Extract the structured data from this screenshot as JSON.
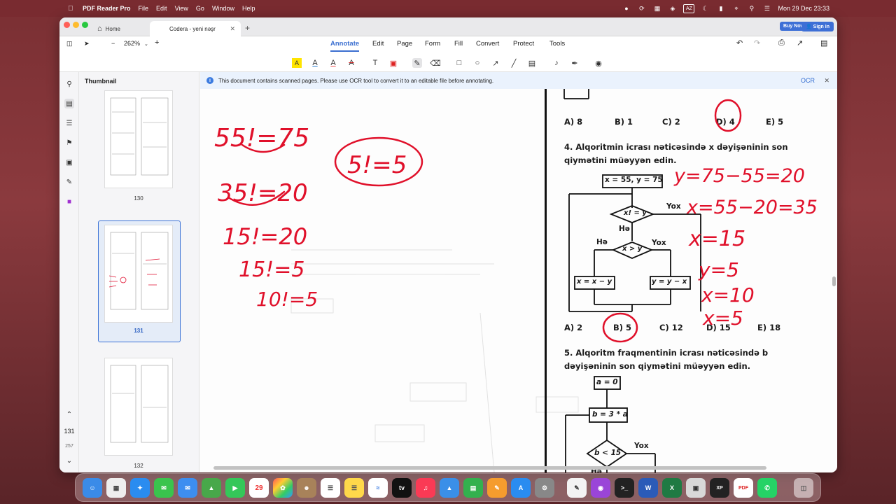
{
  "menubar": {
    "app": "PDF Reader Pro",
    "items": [
      "File",
      "Edit",
      "View",
      "Go",
      "Window",
      "Help"
    ],
    "clock": "Mon 29 Dec  23:33",
    "input_source": "AZ"
  },
  "tabs": {
    "home": "Home",
    "doc": "Codera - yeni nəşr"
  },
  "account": {
    "buy": "Buy Now",
    "signin": "Sign in"
  },
  "toolbar": {
    "zoom": "262%",
    "menu": [
      "Annotate",
      "Edit",
      "Page",
      "Form",
      "Fill",
      "Convert",
      "Protect",
      "Tools"
    ],
    "active": "Annotate"
  },
  "sidebar": {
    "title": "Thumbnail",
    "pages": [
      "130",
      "131",
      "132"
    ],
    "current_page": "131",
    "total_pages": "257"
  },
  "banner": {
    "message": "This document contains scanned pages. Please use OCR tool to convert it to an editable file before annotating.",
    "ocr": "OCR"
  },
  "doc": {
    "answers_q3": [
      "A) 8",
      "B) 1",
      "C) 2",
      "D) 4",
      "E) 5"
    ],
    "q4_line1": "4. Alqoritmin icrası nəticəsində x dəyişəninin son",
    "q4_line2": "qiymətini müəyyən edin.",
    "q4_start": "x = 55, y = 75",
    "q4_cond1": "x! = y",
    "q4_cond2": "x > y",
    "q4_act_left": "x = x − y",
    "q4_act_right": "y = y − x",
    "yes": "Hə",
    "no": "Yox",
    "answers_q4": [
      "A) 2",
      "B) 5",
      "C) 12",
      "D) 15",
      "E) 18"
    ],
    "q5_line1": "5. Alqoritm fraqmentinin icrası nəticəsində b",
    "q5_line2": "dəyişəninin son qiymətini müəyyən edin.",
    "q5_init": "a = 0",
    "q5_act": "b = 3 * a",
    "q5_cond": "b < 15",
    "hw_left": [
      "55!=75",
      "35!=20",
      "15!=20",
      "15!=5",
      "10!=5"
    ],
    "hw_mid": "5!=5",
    "hw_right": [
      "y=75−55=20",
      "x=55−20=35",
      "x=15",
      "y=5",
      "x=10",
      "x=5"
    ]
  },
  "colors": {
    "accent": "#3b6fd0",
    "ink": "#e0102a"
  }
}
